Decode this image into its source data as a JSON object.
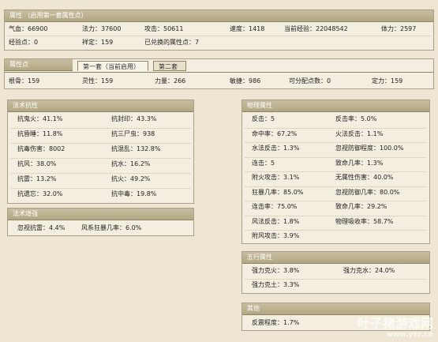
{
  "attr_panel": {
    "title": "属性",
    "subtitle": "（启用第一套属性点）",
    "row1": [
      {
        "label": "气血：",
        "value": "66900"
      },
      {
        "label": "法力：",
        "value": "37600"
      },
      {
        "label": "攻击：",
        "value": "50611"
      },
      {
        "label": "速度：",
        "value": "1418"
      },
      {
        "label": "当前经验：",
        "value": "22048542"
      },
      {
        "label": "体力：",
        "value": "2597"
      }
    ],
    "row2": [
      {
        "label": "经验点：",
        "value": "0"
      },
      {
        "label": "祥定：",
        "value": "159"
      },
      {
        "label": "已兑换的属性点：",
        "value": "7"
      }
    ]
  },
  "points_panel": {
    "title": "属性点",
    "tabs": [
      "第一套（当前启用）",
      "第二套"
    ],
    "row": [
      {
        "label": "根骨：",
        "value": "159"
      },
      {
        "label": "灵性：",
        "value": "159"
      },
      {
        "label": "力量：",
        "value": "266"
      },
      {
        "label": "敏捷：",
        "value": "986"
      },
      {
        "label": "可分配点数：",
        "value": "0"
      },
      {
        "label": "定力：",
        "value": "159"
      }
    ]
  },
  "resist_panel": {
    "title": "法术抗性",
    "rows": [
      [
        "抗鬼火：41.1%",
        "抗封印：43.3%"
      ],
      [
        "抗昏睡：11.8%",
        "抗三尸虫：938"
      ],
      [
        "抗毒伤害：8002",
        "抗混乱：132.8%"
      ],
      [
        "抗风：38.0%",
        "抗水：16.2%"
      ],
      [
        "抗雷：13.2%",
        "抗火：49.2%"
      ],
      [
        "抗遗忘：32.0%",
        "抗中毒：19.8%"
      ]
    ]
  },
  "enhance_panel": {
    "title": "法术增强",
    "rows": [
      [
        "忽视抗雷：4.4%",
        "风系狂暴几率：6.0%"
      ]
    ]
  },
  "phys_panel": {
    "title": "物理属性",
    "rows": [
      [
        "反击：5",
        "反击率：5.0%"
      ],
      [
        "命中率：67.2%",
        "火法反击：1.1%"
      ],
      [
        "水法反击：1.3%",
        "忽视防御程度：100.0%"
      ],
      [
        "连击：5",
        "致命几率：1.3%"
      ],
      [
        "附火攻击：3.1%",
        "无属性伤害：40.0%"
      ],
      [
        "狂暴几率：85.0%",
        "忽视防御几率：80.0%"
      ],
      [
        "连击率：75.0%",
        "致命几率：29.2%"
      ],
      [
        "风法反击：1.8%",
        "物理吸收率：58.7%"
      ],
      [
        "附风攻击：3.9%",
        ""
      ]
    ]
  },
  "five_panel": {
    "title": "五行属性",
    "rows": [
      [
        "强力克火：3.8%",
        "强力克水：24.0%"
      ],
      [
        "强力克土：3.3%",
        ""
      ]
    ]
  },
  "other_panel": {
    "title": "其他",
    "rows": [
      [
        "反震程度：1.7%",
        ""
      ]
    ]
  },
  "watermark": {
    "text": "叶子猪游戏网",
    "url": "www.yzz.cn"
  }
}
